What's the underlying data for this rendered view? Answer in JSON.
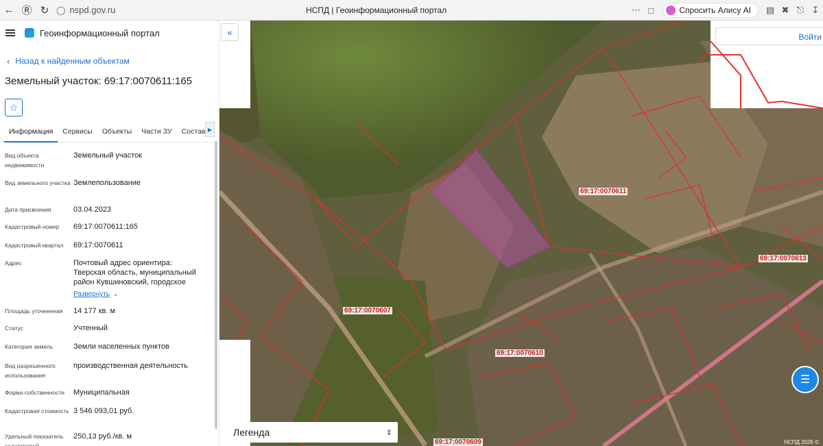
{
  "browser": {
    "url": "nspd.gov.ru",
    "tab_title": "НСПД | Геоинформационный портал",
    "alice_label": "Спросить Алису AI"
  },
  "portal": {
    "name": "Геоинформационный портал"
  },
  "nav": {
    "back_label": "Назад к найденным объектам"
  },
  "object": {
    "title": "Земельный участок: 69:17:0070611:165"
  },
  "tabs": [
    {
      "label": "Информация",
      "active": true
    },
    {
      "label": "Сервисы"
    },
    {
      "label": "Объекты"
    },
    {
      "label": "Части ЗУ"
    },
    {
      "label": "Состав"
    }
  ],
  "properties": [
    {
      "label": "Вид объекта недвижимости",
      "value": "Земельный участок"
    },
    {
      "label": "Вид земельного участка",
      "value": "Землепользование"
    },
    {
      "label": "Дата присвоения",
      "value": "03.04.2023"
    },
    {
      "label": "Кадастровый номер",
      "value": "69:17:0070611:165"
    },
    {
      "label": "Кадастровый квартал",
      "value": "69:17:0070611"
    },
    {
      "label": "Адрес",
      "value": "Почтовый адрес ориентира: Тверская область, муниципальный район Кувшиновский, городское",
      "expand": "Развернуть"
    },
    {
      "label": "Площадь уточненная",
      "value": "14 177 кв. м"
    },
    {
      "label": "Статус",
      "value": "Учтенный"
    },
    {
      "label": "Категория земель",
      "value": "Земли населенных пунктов"
    },
    {
      "label": "Вид разрешенного использования",
      "value": "производственная деятельность"
    },
    {
      "label": "Форма собственности",
      "value": "Муниципальная"
    },
    {
      "label": "Кадастровая стоимость",
      "value": "3 546 093,01 руб."
    },
    {
      "label": "Удельный показатель кадастровой",
      "value": "250,13 руб./кв. м"
    }
  ],
  "map": {
    "legend_label": "Легенда",
    "login_label": "Войти",
    "copyright": "НСПД 2026 ©",
    "quarters": [
      {
        "label": "69:17:0070611"
      },
      {
        "label": "69:17:0070613"
      },
      {
        "label": "69:17:0070607"
      },
      {
        "label": "69:17:0070610"
      },
      {
        "label": "69:17:0070609"
      }
    ]
  },
  "colors": {
    "accent": "#1e6fd1",
    "boundary": "#e0302e",
    "selected_parcel": "#b03dab"
  },
  "icons": [
    "back-icon",
    "forward-icon",
    "reload-icon",
    "site-info-icon",
    "menu-icon",
    "bookmark-icon",
    "star-icon",
    "chevron-left-icon",
    "chevron-down-icon",
    "collapse-icon",
    "select-arrows-icon",
    "chat-icon"
  ]
}
